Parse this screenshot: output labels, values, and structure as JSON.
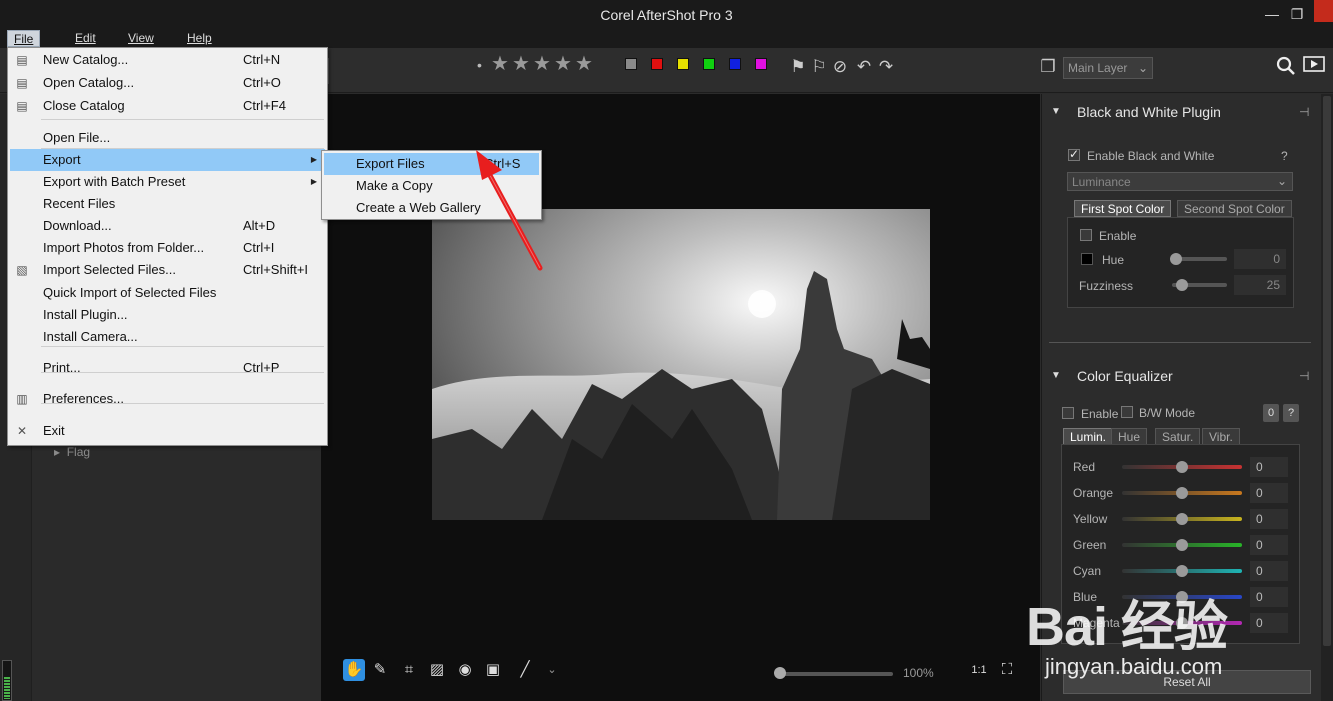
{
  "app": {
    "title": "Corel AfterShot Pro 3"
  },
  "window_controls": {
    "minimize": "—",
    "restore": "❐",
    "close": ""
  },
  "menubar": [
    "File",
    "Edit",
    "View",
    "Help"
  ],
  "toolbar": {
    "rating_dot": "•",
    "stars": [
      "★",
      "★",
      "★",
      "★",
      "★"
    ],
    "color_labels": [
      "#8a8a8a",
      "#e01010",
      "#e6e000",
      "#10d010",
      "#1020e0",
      "#e010e0"
    ],
    "layer_select": "Main Layer"
  },
  "file_menu": {
    "items": [
      {
        "label": "New Catalog...",
        "key": "Ctrl+N",
        "icon": "catalog-icon"
      },
      {
        "label": "Open Catalog...",
        "key": "Ctrl+O",
        "icon": "catalog-icon"
      },
      {
        "label": "Close Catalog",
        "key": "Ctrl+F4",
        "icon": "catalog-icon"
      },
      {
        "label": "Open File...",
        "key": ""
      },
      {
        "label": "Export",
        "key": "",
        "submenu": true,
        "highlighted": true
      },
      {
        "label": "Export with Batch Preset",
        "key": "",
        "submenu": true
      },
      {
        "label": "Recent Files",
        "key": ""
      },
      {
        "label": "Download...",
        "key": "Alt+D"
      },
      {
        "label": "Import Photos from Folder...",
        "key": "Ctrl+I"
      },
      {
        "label": "Import Selected Files...",
        "key": "Ctrl+Shift+I",
        "icon": "import-icon"
      },
      {
        "label": "Quick Import of Selected Files",
        "key": ""
      },
      {
        "label": "Install Plugin...",
        "key": ""
      },
      {
        "label": "Install Camera...",
        "key": ""
      },
      {
        "label": "Print...",
        "key": "Ctrl+P"
      },
      {
        "label": "Preferences...",
        "key": "",
        "icon": "preferences-icon"
      },
      {
        "label": "Exit",
        "key": "",
        "icon": "exit-icon"
      }
    ]
  },
  "export_submenu": {
    "items": [
      {
        "label": "Export Files",
        "key": "Ctrl+S",
        "highlighted": true
      },
      {
        "label": "Make a Copy",
        "key": ""
      },
      {
        "label": "Create a Web Gallery",
        "key": ""
      }
    ]
  },
  "left_panel": {
    "flag_label": "Flag"
  },
  "viewer": {
    "zoom": "100%",
    "zoom_fraction": 0.0
  },
  "bw_plugin": {
    "title": "Black and White Plugin",
    "enable_label": "Enable Black and White",
    "enabled": true,
    "help": "?",
    "mode": "Luminance",
    "tabs": [
      "First Spot Color",
      "Second Spot Color"
    ],
    "spot_enable_label": "Enable",
    "hue_label": "Hue",
    "hue_value": "0",
    "fuzziness_label": "Fuzziness",
    "fuzziness_value": "25"
  },
  "color_equalizer": {
    "title": "Color Equalizer",
    "enable_label": "Enable",
    "bw_mode_label": "B/W Mode",
    "zero_btn": "0",
    "help": "?",
    "tabs": [
      "Lumin.",
      "Hue",
      "Satur.",
      "Vibr."
    ],
    "channels": [
      {
        "name": "Red",
        "value": "0",
        "color": "#c83232"
      },
      {
        "name": "Orange",
        "value": "0",
        "color": "#c8781e"
      },
      {
        "name": "Yellow",
        "value": "0",
        "color": "#c8b41e"
      },
      {
        "name": "Green",
        "value": "0",
        "color": "#28b428"
      },
      {
        "name": "Cyan",
        "value": "0",
        "color": "#1eb4b4"
      },
      {
        "name": "Blue",
        "value": "0",
        "color": "#2846c8"
      },
      {
        "name": "Magenta",
        "value": "0",
        "color": "#b428b4"
      }
    ]
  },
  "reset_all": "Reset All",
  "watermark": {
    "logo": "Bai 经验",
    "url": "jingyan.baidu.com"
  }
}
